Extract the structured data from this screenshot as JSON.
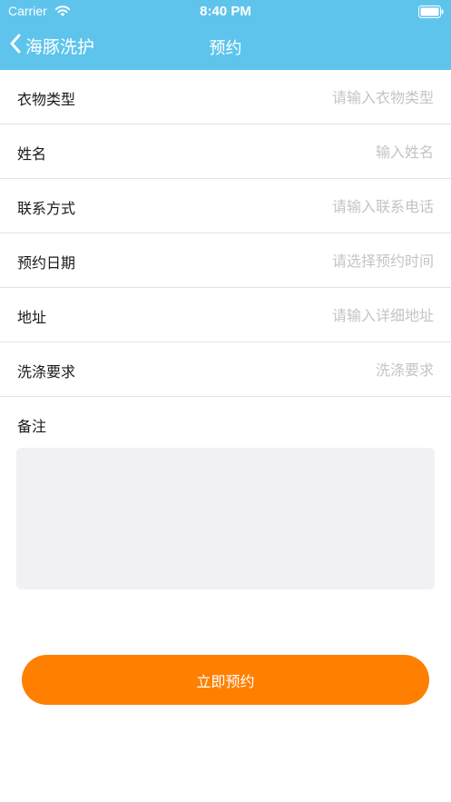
{
  "status_bar": {
    "carrier": "Carrier",
    "time": "8:40 PM"
  },
  "nav": {
    "back_label": "海豚洗护",
    "title": "预约"
  },
  "form": {
    "fields": [
      {
        "label": "衣物类型",
        "placeholder": "请输入衣物类型",
        "value": ""
      },
      {
        "label": "姓名",
        "placeholder": "输入姓名",
        "value": ""
      },
      {
        "label": "联系方式",
        "placeholder": "请输入联系电话",
        "value": ""
      },
      {
        "label": "预约日期",
        "placeholder": "请选择预约时间",
        "value": ""
      },
      {
        "label": "地址",
        "placeholder": "请输入详细地址",
        "value": ""
      },
      {
        "label": "洗涤要求",
        "placeholder": "洗涤要求",
        "value": ""
      }
    ],
    "notes_label": "备注",
    "notes_value": ""
  },
  "submit_label": "立即预约",
  "colors": {
    "header": "#5ec4ec",
    "accent": "#ff7f00",
    "notes_bg": "#f1f1f5"
  }
}
